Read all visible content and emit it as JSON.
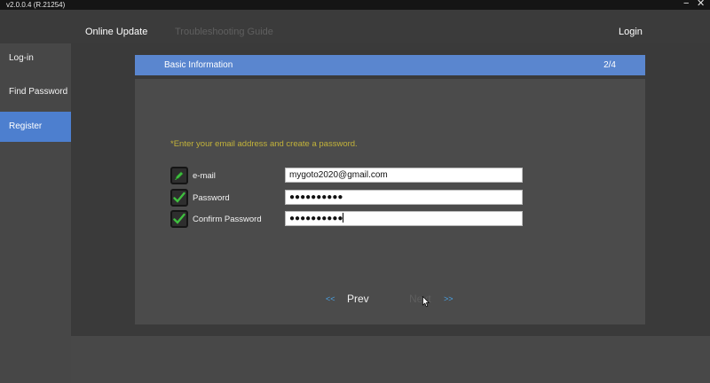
{
  "window": {
    "version": "v2.0.0.4  (R.21254)",
    "minimize_glyph": "−",
    "close_glyph": "✕"
  },
  "topnav": {
    "online_update": "Online Update",
    "troubleshooting": "Troubleshooting Guide",
    "login": "Login"
  },
  "sidebar": {
    "items": [
      {
        "label": "Log-in"
      },
      {
        "label": "Find Password"
      },
      {
        "label": "Register"
      }
    ]
  },
  "section": {
    "title": "Basic Information",
    "step": "2/4"
  },
  "form": {
    "instruction": "*Enter your email address and create a password.",
    "rows": [
      {
        "label": "e-mail",
        "value": "mygoto2020@gmail.com",
        "icon": "pencil-icon"
      },
      {
        "label": "Password",
        "value": "●●●●●●●●●●",
        "icon": "check-icon"
      },
      {
        "label": "Confirm Password",
        "value": "●●●●●●●●●●",
        "icon": "check-icon"
      }
    ]
  },
  "pager": {
    "prev_arrows": "<<",
    "prev": "Prev",
    "next": "Next",
    "next_arrows": ">>"
  },
  "colors": {
    "accent": "#4d7fcf",
    "header": "#5a86cf",
    "instruction": "#c3b33a",
    "check_green": "#3fbf3f",
    "arrows": "#4aa3e6"
  }
}
